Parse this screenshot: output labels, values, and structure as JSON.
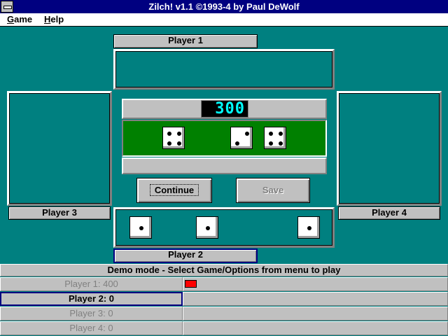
{
  "window": {
    "title": "Zilch! v1.1 ©1993-4 by Paul DeWolf"
  },
  "menu": {
    "items": [
      "Game",
      "Help"
    ]
  },
  "players": {
    "p1": "Player 1",
    "p2": "Player 2",
    "p3": "Player 3",
    "p4": "Player 4"
  },
  "round": {
    "score_display": "300",
    "rolled_dice": [
      4,
      2,
      4
    ],
    "held_dice": [
      1,
      1,
      1
    ]
  },
  "buttons": {
    "continue": "Continue",
    "save": "Save"
  },
  "status": {
    "message": "Demo mode - Select Game/Options from menu to play"
  },
  "scores": [
    {
      "label": "Player 1:  400",
      "state": "dim",
      "progress": 0.045
    },
    {
      "label": "Player 2:  0",
      "state": "active",
      "progress": 0
    },
    {
      "label": "Player 3:  0",
      "state": "dim",
      "progress": 0
    },
    {
      "label": "Player 4:  0",
      "state": "dim",
      "progress": 0
    }
  ],
  "colors": {
    "felt": "#008080",
    "table": "#008000",
    "progress": "#ff0000",
    "lcd_text": "#00ffff"
  }
}
